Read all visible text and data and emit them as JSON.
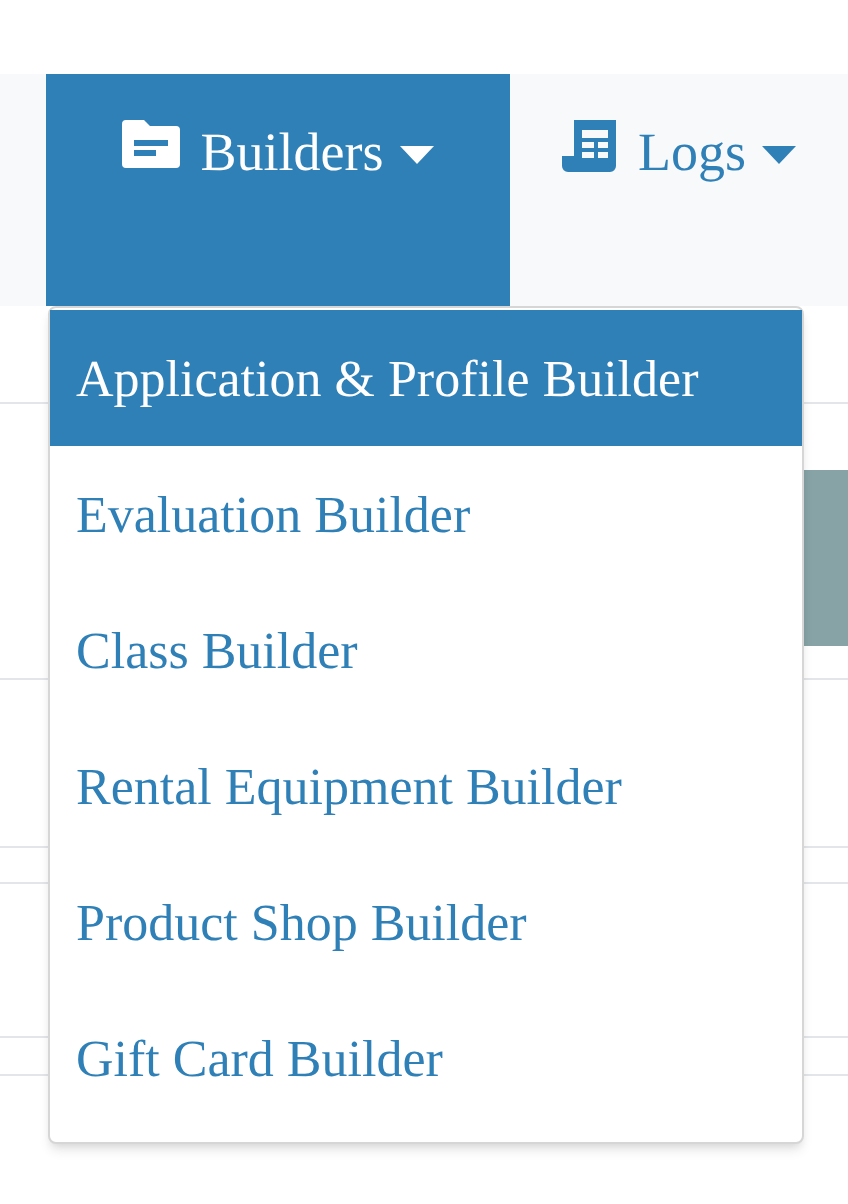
{
  "nav": {
    "tabs": [
      {
        "label": "Builders",
        "kind": "folder",
        "selected": true
      },
      {
        "label": "Logs",
        "kind": "receipt",
        "selected": false
      }
    ]
  },
  "dropdown": {
    "items": [
      {
        "label": "Application & Profile Builder",
        "selected": true
      },
      {
        "label": "Evaluation Builder",
        "selected": false
      },
      {
        "label": "Class Builder",
        "selected": false
      },
      {
        "label": "Rental Equipment Builder",
        "selected": false
      },
      {
        "label": "Product Shop Builder",
        "selected": false
      },
      {
        "label": "Gift Card Builder",
        "selected": false
      }
    ]
  }
}
